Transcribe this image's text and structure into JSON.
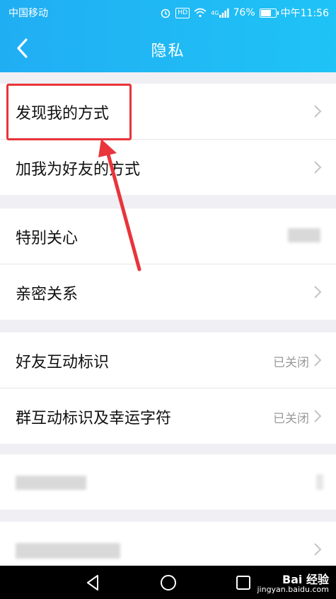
{
  "status_bar": {
    "carrier": "中国移动",
    "hd_badge": "HD",
    "network": "4G",
    "battery": "76%",
    "battery_level": 0.76,
    "time": "中午11:56"
  },
  "nav": {
    "title": "隐私"
  },
  "groups": [
    {
      "items": [
        {
          "label": "发现我的方式",
          "value": ""
        },
        {
          "label": "加我为好友的方式",
          "value": ""
        }
      ]
    },
    {
      "items": [
        {
          "label": "特别关心",
          "value": ""
        },
        {
          "label": "亲密关系",
          "value": ""
        }
      ]
    },
    {
      "items": [
        {
          "label": "好友互动标识",
          "value": "已关闭"
        },
        {
          "label": "群互动标识及幸运字符",
          "value": "已关闭"
        }
      ]
    }
  ],
  "watermark": {
    "brand": "Bai 经验",
    "url": "jingyan.baidu.com"
  },
  "colors": {
    "header_start": "#20aef3",
    "header_end": "#1fc3f6",
    "highlight": "#e8343a"
  },
  "icons": [
    "chevron-left-icon",
    "chevron-right-icon",
    "alarm-icon",
    "wifi-icon",
    "signal-icon",
    "battery-icon",
    "back-triangle-icon",
    "home-circle-icon",
    "recents-square-icon"
  ]
}
